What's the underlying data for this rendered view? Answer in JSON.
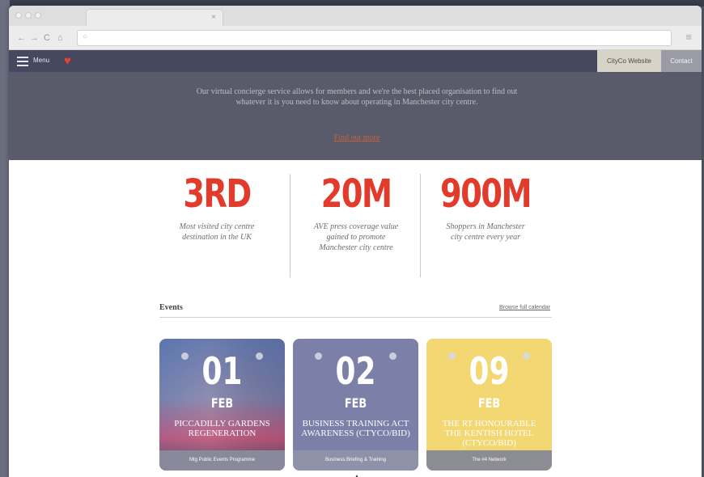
{
  "browser": {
    "tab_close_icon": "×",
    "nav_buttons": [
      "←",
      "→",
      "C",
      "⌂"
    ],
    "menu_icon": "≡"
  },
  "site_header": {
    "menu_label": "Menu",
    "logo_icon": "heart-icon",
    "logo_color": "#e8412f",
    "website_button": "CityCo Website",
    "contact_button": "Contact"
  },
  "hero": {
    "text": "Our virtual concierge service allows for members and we're the best placed organisation to find out whatever it is you need to know about operating in Manchester city centre.",
    "link": "Find out more"
  },
  "stats": [
    {
      "value": "3RD",
      "caption": "Most visited city centre destination in the UK"
    },
    {
      "value": "20M",
      "caption": "AVE press coverage value gained to promote Manchester city centre"
    },
    {
      "value": "900M",
      "caption": "Shoppers in Manchester city centre every year"
    }
  ],
  "events": {
    "title": "Events",
    "browse_link": "Browse full calendar",
    "cards": [
      {
        "day": "01",
        "month": "FEB",
        "title": "Piccadilly Gardens Regeneration",
        "footer": "Mtg Public Events Programme"
      },
      {
        "day": "02",
        "month": "FEB",
        "title": "Business Training ACT Awareness (CTYCO/BID)",
        "footer": "Business Briefing & Training"
      },
      {
        "day": "09",
        "month": "FEB",
        "title": "The Rt Honourable The Kentish Hotel (CTYCO/BID)",
        "footer": "The #4 Network"
      }
    ]
  },
  "colors": {
    "accent_red": "#e33b2b",
    "header_bg": "#45485e",
    "hero_bg": "#595b6a",
    "card_blue": "#7c7fa8",
    "card_yellow": "#f2d772"
  }
}
